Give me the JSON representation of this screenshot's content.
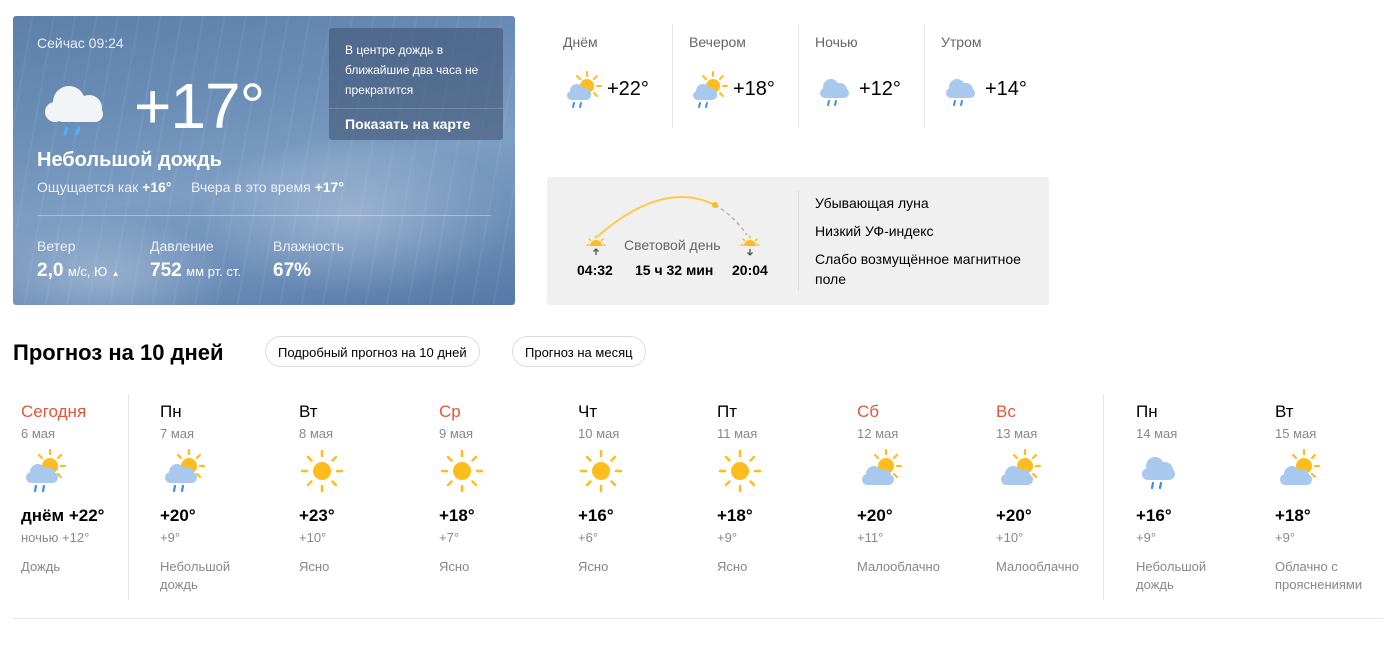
{
  "now": {
    "time": "Сейчас 09:24",
    "temp": "+17°",
    "condition": "Небольшой дождь",
    "feels_label": "Ощущается как",
    "feels_value": "+16°",
    "yesterday_label": "Вчера в это время",
    "yesterday_value": "+17°",
    "icon": "cloud-rain-icon",
    "wind": {
      "label": "Ветер",
      "value": "2,0",
      "unit": "м/с, Ю",
      "arrow": "▲"
    },
    "pressure": {
      "label": "Давление",
      "value": "752",
      "unit": "мм рт. ст."
    },
    "humidity": {
      "label": "Влажность",
      "value": "67%"
    },
    "alert": {
      "text": "В центре дождь в ближайшие два часа не прекратится",
      "link": "Показать на карте"
    }
  },
  "day_parts": [
    {
      "name": "Днём",
      "temp": "+22°",
      "icon": "sun-cloud-rain-icon"
    },
    {
      "name": "Вечером",
      "temp": "+18°",
      "icon": "sun-cloud-rain-icon"
    },
    {
      "name": "Ночью",
      "temp": "+12°",
      "icon": "cloud-rain-icon"
    },
    {
      "name": "Утром",
      "temp": "+14°",
      "icon": "cloud-rain-icon"
    }
  ],
  "sun": {
    "label": "Световой день",
    "sunrise": "04:32",
    "duration": "15 ч 32 мин",
    "sunset": "20:04",
    "moon": "Убывающая луна",
    "uv": "Низкий УФ-индекс",
    "magnetic": "Слабо возмущённое магнитное поле"
  },
  "forecast": {
    "title": "Прогноз на 10 дней",
    "btn_detailed": "Подробный прогноз на 10 дней",
    "btn_month": "Прогноз на месяц",
    "days": [
      {
        "name": "Сегодня",
        "date": "6 мая",
        "hi": "днём +22°",
        "lo": "ночью +12°",
        "cond": "Дождь",
        "icon": "sun-cloud-rain-icon",
        "holiday": true
      },
      {
        "name": "Пн",
        "date": "7 мая",
        "hi": "+20°",
        "lo": "+9°",
        "cond": "Небольшой дождь",
        "icon": "sun-cloud-rain-icon",
        "holiday": false
      },
      {
        "name": "Вт",
        "date": "8 мая",
        "hi": "+23°",
        "lo": "+10°",
        "cond": "Ясно",
        "icon": "sun-icon",
        "holiday": false
      },
      {
        "name": "Ср",
        "date": "9 мая",
        "hi": "+18°",
        "lo": "+7°",
        "cond": "Ясно",
        "icon": "sun-icon",
        "holiday": true
      },
      {
        "name": "Чт",
        "date": "10 мая",
        "hi": "+16°",
        "lo": "+6°",
        "cond": "Ясно",
        "icon": "sun-icon",
        "holiday": false
      },
      {
        "name": "Пт",
        "date": "11 мая",
        "hi": "+18°",
        "lo": "+9°",
        "cond": "Ясно",
        "icon": "sun-icon",
        "holiday": false
      },
      {
        "name": "Сб",
        "date": "12 мая",
        "hi": "+20°",
        "lo": "+11°",
        "cond": "Малооблачно",
        "icon": "sun-cloud-icon",
        "holiday": true
      },
      {
        "name": "Вс",
        "date": "13 мая",
        "hi": "+20°",
        "lo": "+10°",
        "cond": "Малооблачно",
        "icon": "sun-cloud-icon",
        "holiday": true
      },
      {
        "name": "Пн",
        "date": "14 мая",
        "hi": "+16°",
        "lo": "+9°",
        "cond": "Небольшой дождь",
        "icon": "cloud-rain-icon",
        "holiday": false
      },
      {
        "name": "Вт",
        "date": "15 мая",
        "hi": "+18°",
        "lo": "+9°",
        "cond": "Облачно с прояснениями",
        "icon": "sun-cloud-icon",
        "holiday": false
      }
    ]
  },
  "colors": {
    "holiday": "#e0573c",
    "sun": "#ffbc1f",
    "cloud": "#a9c8ee",
    "rain": "#3b8fe6"
  }
}
